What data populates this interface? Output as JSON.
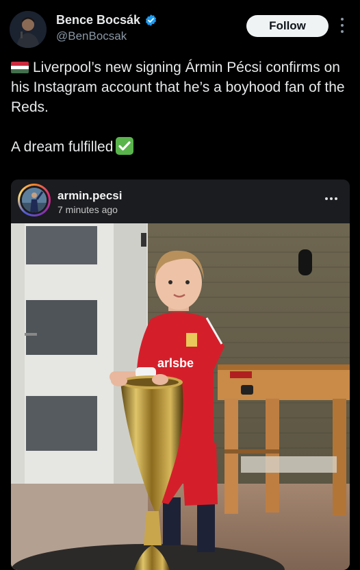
{
  "author": {
    "name": "Bence Bocsák",
    "handle": "@BenBocsak",
    "verified": true,
    "avatar_icon": "profile-photo"
  },
  "follow_label": "Follow",
  "more_icon": "more-vertical-icon",
  "tweet": {
    "line1": "Liverpool’s new signing Ármin Pécsi confirms on his Instagram account that he’s a boyhood fan of the Reds.",
    "line2": "A dream fulfilled",
    "flag_icon": "hungary-flag-icon",
    "check_icon": "check-mark-button-icon"
  },
  "embed": {
    "username": "armin.pecsi",
    "time": "7 minutes ago",
    "more_icon": "more-horizontal-icon",
    "photo_shirt_text": "arlsbe"
  },
  "colors": {
    "background": "#000000",
    "text": "#e7e9ea",
    "muted": "#8b98a5",
    "verified": "#1d9bf0",
    "follow_bg": "#eff3f4",
    "card_bg": "#1a1c1f",
    "liverpool_red": "#d41f2b"
  }
}
